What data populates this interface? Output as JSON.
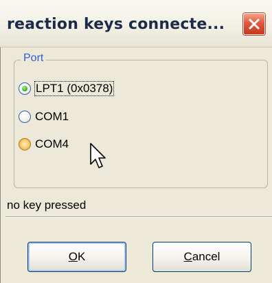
{
  "window": {
    "title": "reaction keys connecte..."
  },
  "port_group": {
    "legend": "Port",
    "options": [
      {
        "label": "LPT1 (0x0378)",
        "selected": true,
        "focused": true
      },
      {
        "label": "COM1",
        "selected": false
      },
      {
        "label": "COM4",
        "selected": false,
        "hovered": true
      }
    ]
  },
  "status": {
    "text": "no key pressed"
  },
  "buttons": {
    "ok": {
      "mnemonic": "O",
      "rest": "K"
    },
    "cancel": {
      "mnemonic": "C",
      "rest": "ancel"
    }
  },
  "colors": {
    "legend": "#2e5cd1",
    "close_button": "#e2573c",
    "dialog_background": "#ece9d8"
  },
  "icons": {
    "close": "close-icon",
    "pointer": "mouse-pointer-icon",
    "radio_selected": "radio-selected-icon",
    "radio_unselected": "radio-unselected-icon"
  }
}
